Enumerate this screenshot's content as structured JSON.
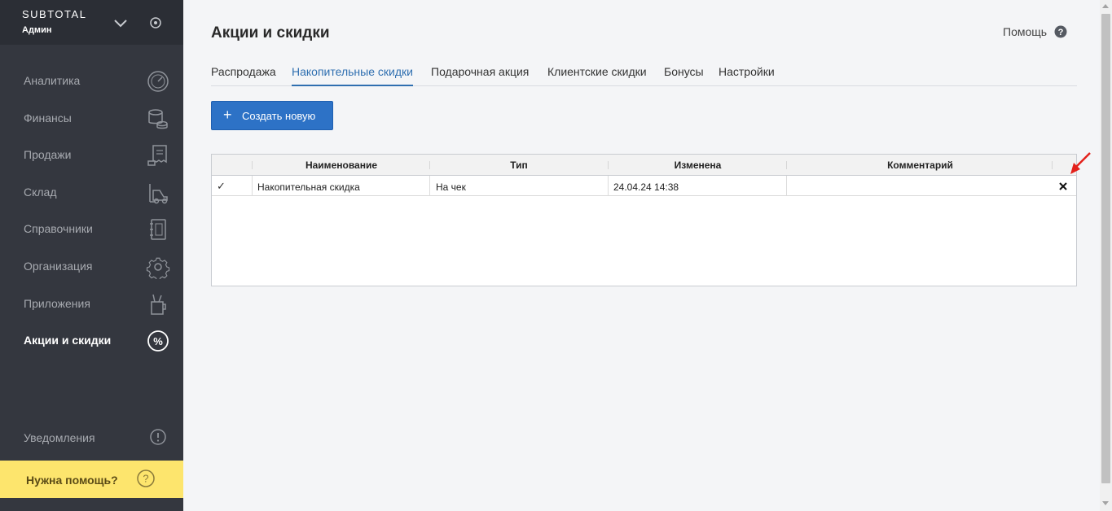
{
  "sidebar": {
    "brand": "SUBTOTAL",
    "role": "Админ",
    "nav": [
      {
        "label": "Аналитика",
        "icon": "speedometer-icon"
      },
      {
        "label": "Финансы",
        "icon": "coins-icon"
      },
      {
        "label": "Продажи",
        "icon": "receipt-icon"
      },
      {
        "label": "Склад",
        "icon": "forklift-icon"
      },
      {
        "label": "Справочники",
        "icon": "notebook-icon"
      },
      {
        "label": "Организация",
        "icon": "gear-icon"
      },
      {
        "label": "Приложения",
        "icon": "tools-cup-icon"
      },
      {
        "label": "Акции и скидки",
        "icon": "percent-badge-icon",
        "active": true
      }
    ],
    "notifications": "Уведомления",
    "help": "Нужна помощь?"
  },
  "header": {
    "title": "Акции и скидки",
    "help_link": "Помощь"
  },
  "tabs": [
    "Распродажа",
    "Накопительные скидки",
    "Подарочная акция",
    "Клиентские скидки",
    "Бонусы",
    "Настройки"
  ],
  "active_tab": "Накопительные скидки",
  "create_button": "Создать новую",
  "table": {
    "columns": [
      "Наименование",
      "Тип",
      "Изменена",
      "Комментарий"
    ],
    "rows": [
      {
        "check": "✓",
        "name": "Накопительная скидка",
        "type": "На чек",
        "changed": "24.04.24 14:38",
        "comment": ""
      }
    ]
  },
  "colors": {
    "sidebar": "#34373f",
    "accent": "#2d72c6",
    "help_bar": "#fde56d",
    "annotation_arrow": "#e3211b"
  }
}
